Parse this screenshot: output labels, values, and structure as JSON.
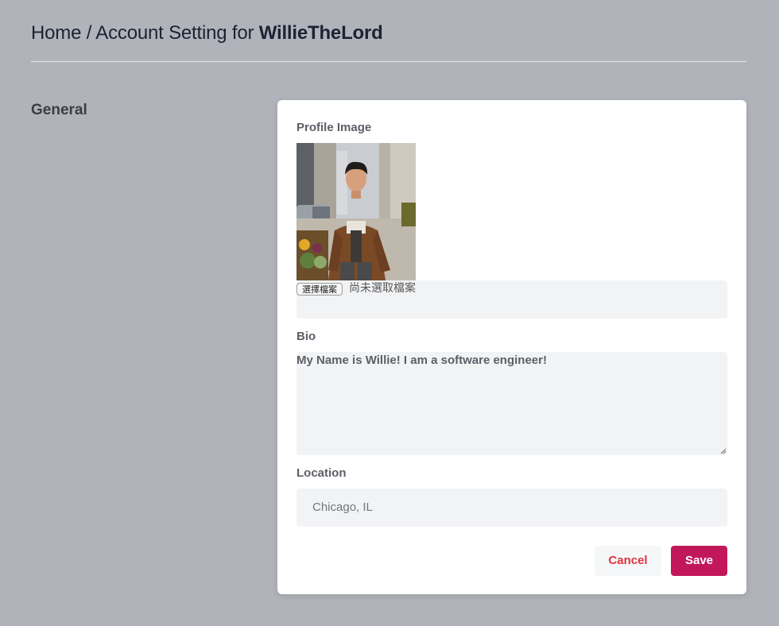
{
  "header": {
    "breadcrumb_prefix": "Home / Account Setting for ",
    "username": "WillieTheLord"
  },
  "section": {
    "title": "General"
  },
  "form": {
    "profile_image_label": "Profile Image",
    "file_button_label": "選擇檔案",
    "file_status": "尚未選取檔案",
    "bio_label": "Bio",
    "bio_value": "My Name is Willie! I am a software engineer!",
    "location_label": "Location",
    "location_placeholder": "Chicago, IL",
    "cancel_label": "Cancel",
    "save_label": "Save"
  },
  "colors": {
    "page_background": "#b0b3b9",
    "save_button": "#c2185b",
    "cancel_text": "#e0313f"
  }
}
